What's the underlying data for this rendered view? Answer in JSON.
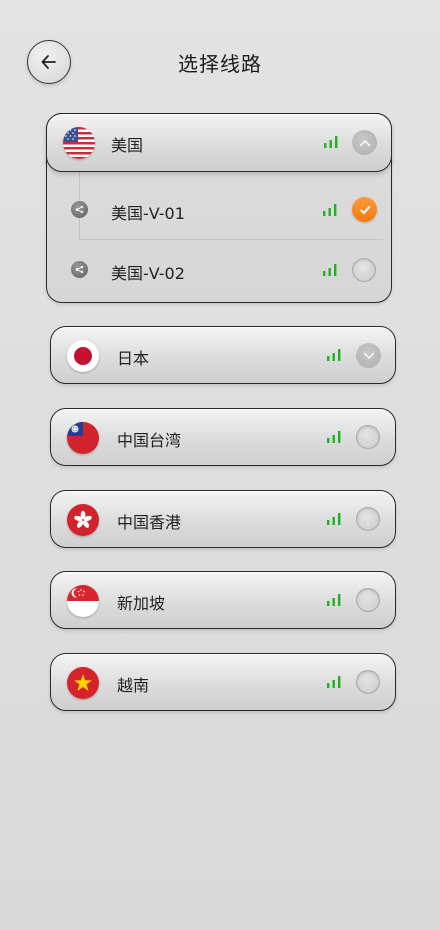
{
  "header": {
    "title": "选择线路"
  },
  "regions": [
    {
      "id": "us",
      "name": "美国",
      "expanded": true,
      "routes": [
        {
          "name": "美国-V-01",
          "selected": true
        },
        {
          "name": "美国-V-02",
          "selected": false
        }
      ]
    },
    {
      "id": "jp",
      "name": "日本",
      "expanded": false,
      "collapsible": true
    },
    {
      "id": "tw",
      "name": "中国台湾"
    },
    {
      "id": "hk",
      "name": "中国香港"
    },
    {
      "id": "sg",
      "name": "新加坡"
    },
    {
      "id": "vn",
      "name": "越南"
    }
  ],
  "colors": {
    "accent": "#f5841f",
    "signal": "#22b022"
  },
  "icons": {
    "back": "arrow-left-icon",
    "signal": "signal-bars-icon",
    "expand": "chevron-icon",
    "route": "server-node-icon",
    "selected": "check-icon"
  }
}
